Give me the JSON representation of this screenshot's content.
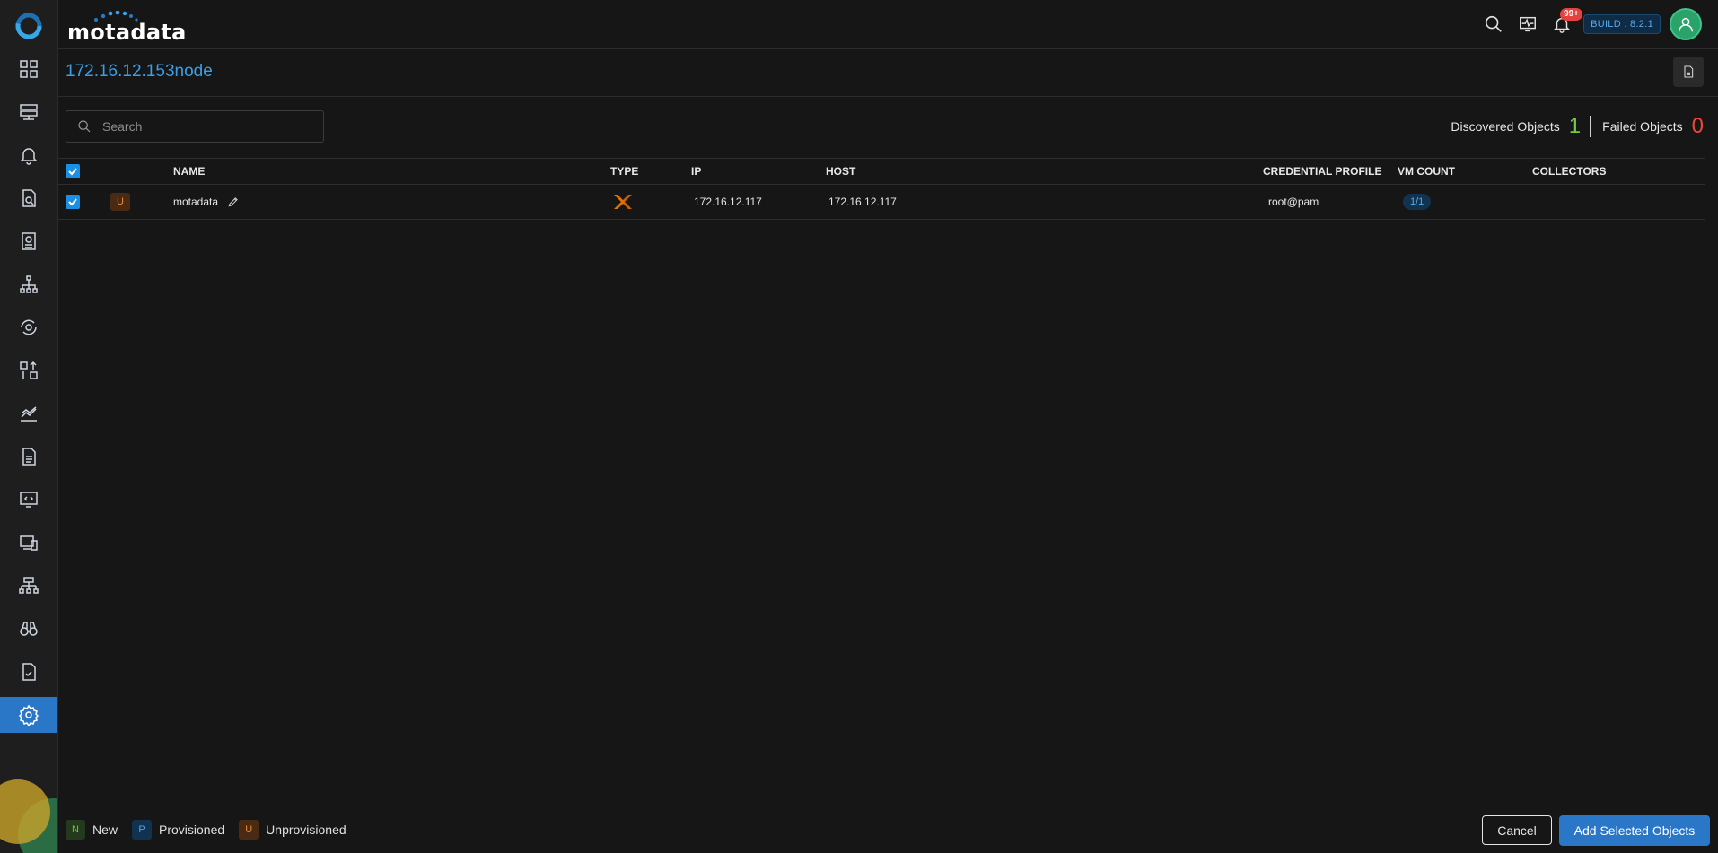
{
  "brand": {
    "name": "motadata"
  },
  "topbar": {
    "notifications_badge": "99+",
    "build_label": "BUILD : 8.2.1"
  },
  "page": {
    "title": "172.16.12.153node"
  },
  "search": {
    "placeholder": "Search",
    "value": ""
  },
  "stats": {
    "discovered_label": "Discovered Objects",
    "discovered_value": "1",
    "failed_label": "Failed Objects",
    "failed_value": "0"
  },
  "table": {
    "columns": [
      "NAME",
      "TYPE",
      "IP",
      "HOST",
      "CREDENTIAL PROFILE",
      "VM COUNT",
      "COLLECTORS"
    ],
    "rows": [
      {
        "selected": true,
        "status": "U",
        "name": "motadata",
        "type_icon": "proxmox-icon",
        "ip": "172.16.12.117",
        "host": "172.16.12.117",
        "credential_profile": "root@pam",
        "vm_count": "1/1",
        "collectors": ""
      }
    ]
  },
  "legend": {
    "new_badge": "N",
    "new_label": "New",
    "provisioned_badge": "P",
    "provisioned_label": "Provisioned",
    "unprovisioned_badge": "U",
    "unprovisioned_label": "Unprovisioned"
  },
  "actions": {
    "cancel": "Cancel",
    "add": "Add Selected Objects"
  },
  "sidebar": {
    "items": [
      "dashboard-icon",
      "servers-icon",
      "alerts-icon",
      "discovery-icon",
      "reports-icon",
      "topology-icon",
      "settings-cycle-icon",
      "flow-icon",
      "metrics-icon",
      "document-icon",
      "code-monitor-icon",
      "devices-icon",
      "network-icon",
      "binoculars-icon",
      "audit-icon",
      "settings-icon"
    ]
  },
  "colors": {
    "accent": "#2b77c7",
    "title": "#3a9ee8",
    "discovered": "#7ac943",
    "failed": "#f0443c",
    "unprovisioned": "#f08a35"
  }
}
